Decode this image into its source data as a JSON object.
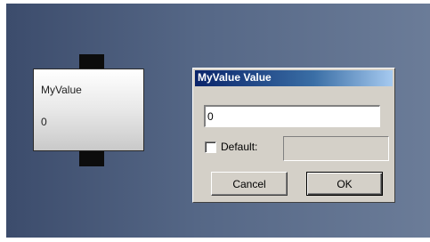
{
  "node": {
    "label": "MyValue",
    "value": "0"
  },
  "dialog": {
    "title": "MyValue Value",
    "value_input": "0",
    "default_checkbox_label": "Default:",
    "default_checked": false,
    "default_value": "",
    "cancel_label": "Cancel",
    "ok_label": "OK"
  },
  "colors": {
    "canvas_bg": "#556786",
    "titlebar_start": "#0a246a",
    "titlebar_end": "#a6caf0",
    "dialog_face": "#d4d0c8"
  }
}
